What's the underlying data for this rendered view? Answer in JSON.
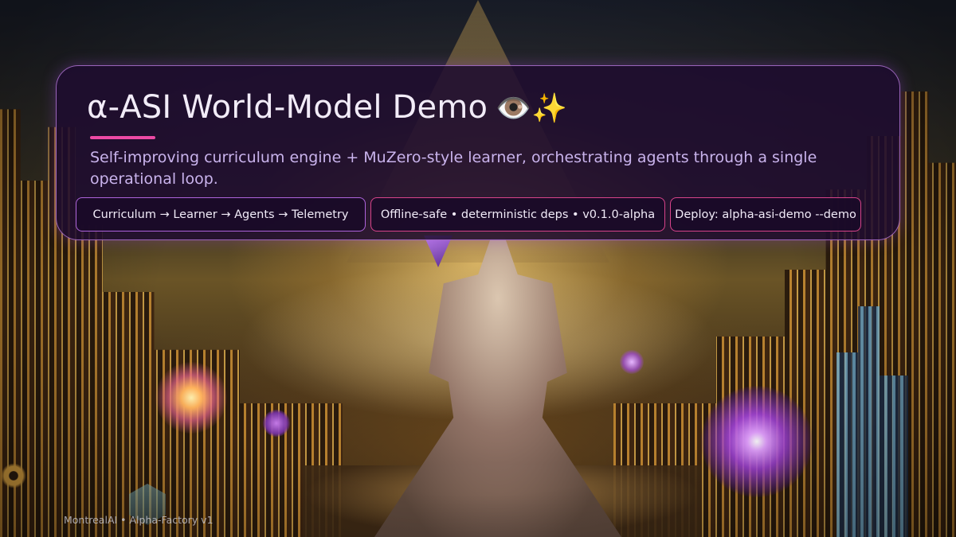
{
  "slide": {
    "title": "α-ASI World-Model Demo",
    "title_emoji": "👁️✨",
    "subtitle": "Self-improving curriculum engine + MuZero-style learner, orchestrating agents through a single operational loop.",
    "chips": [
      "Curriculum → Learner → Agents → Telemetry",
      "Offline-safe • deterministic deps • v0.1.0-alpha",
      "Deploy: alpha-asi-demo --demo"
    ],
    "footer": "MontrealAI • Alpha-Factory v1"
  },
  "colors": {
    "card_bg": "#1e0c30",
    "card_border": "#c482eb",
    "accent": "#ec4aa4",
    "subtitle": "#c9b3ec",
    "chip_border_purple": "#be6ef0",
    "chip_border_pink": "#ec4a96"
  },
  "background": {
    "scene": "futuristic golden city with robed figure, pyramid and glowing orbs"
  }
}
